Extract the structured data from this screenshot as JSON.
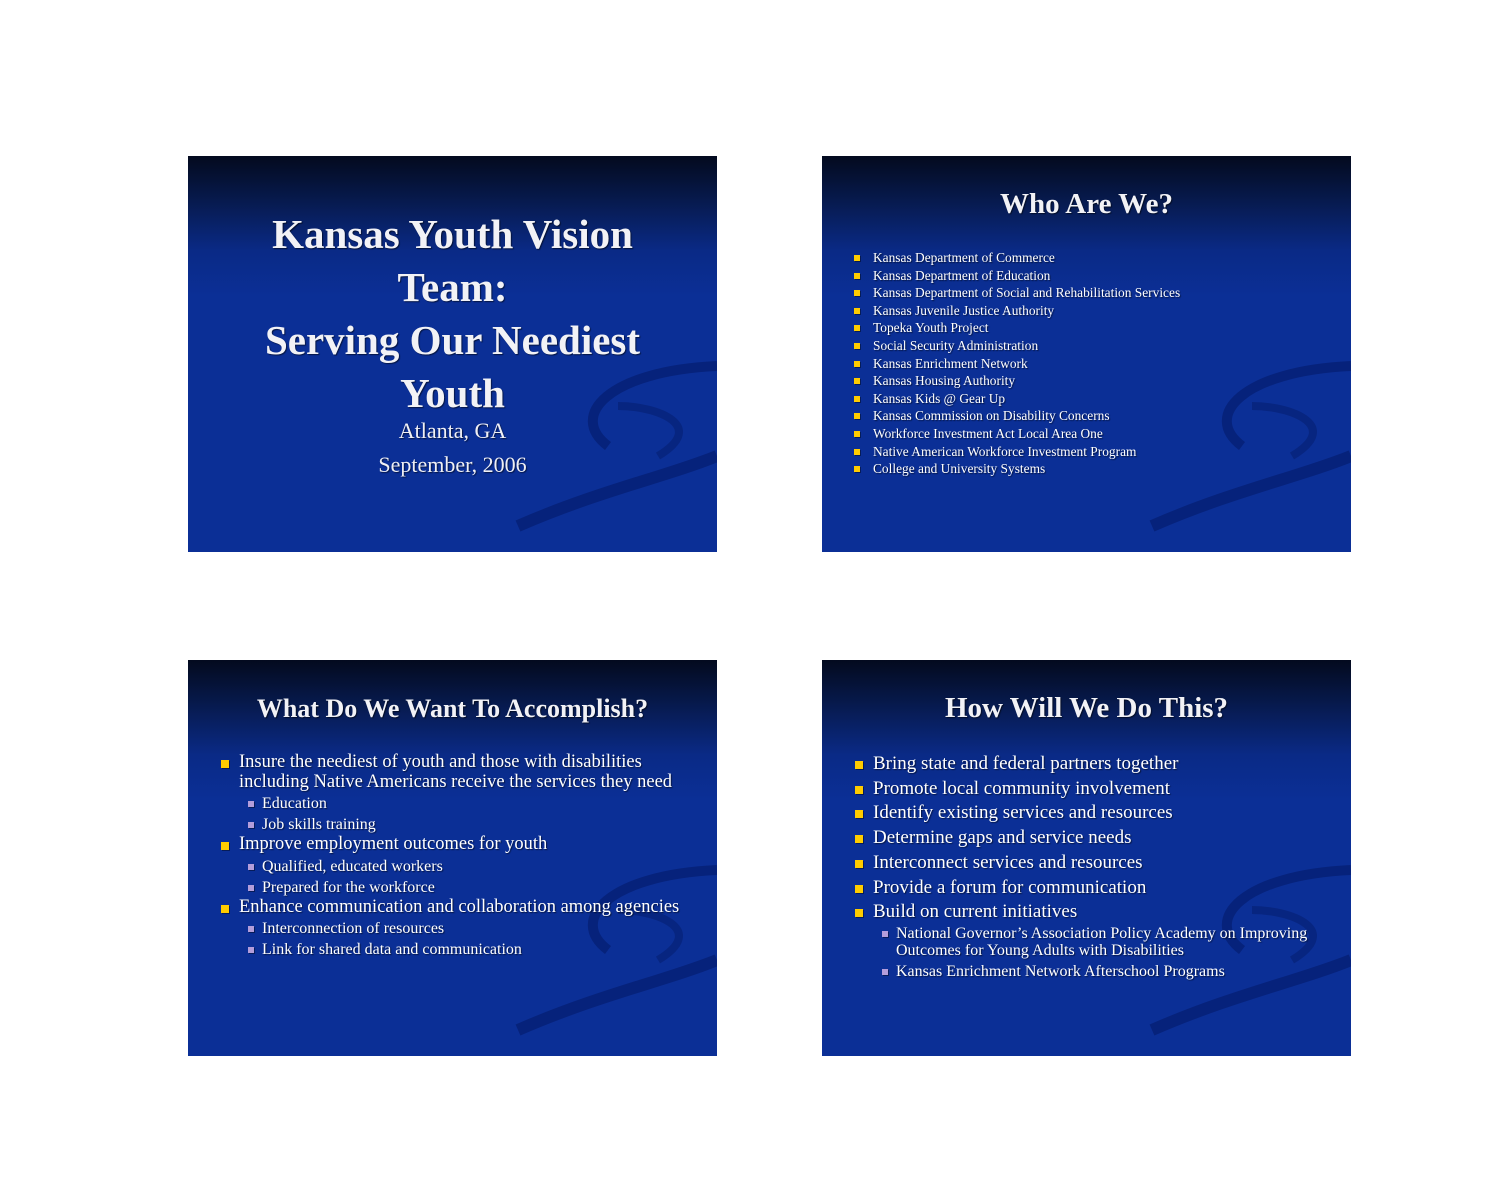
{
  "slides": [
    {
      "title_lines": [
        "Kansas Youth Vision",
        "Team:",
        "Serving Our Neediest",
        "Youth"
      ],
      "subtitle_lines": [
        "Atlanta, GA",
        "September, 2006"
      ]
    },
    {
      "title": "Who Are We?",
      "items": [
        "Kansas Department of Commerce",
        "Kansas Department of Education",
        "Kansas Department of Social and Rehabilitation Services",
        "Kansas Juvenile Justice Authority",
        "Topeka Youth Project",
        "Social Security Administration",
        "Kansas Enrichment Network",
        "Kansas Housing Authority",
        "Kansas Kids @ Gear Up",
        "Kansas Commission on Disability Concerns",
        "Workforce Investment Act Local Area One",
        "Native American Workforce Investment Program",
        "College and University Systems"
      ]
    },
    {
      "title": "What Do We Want To Accomplish?",
      "items": [
        {
          "text": "Insure the neediest of youth and those with disabilities including Native Americans receive the services they need",
          "sub": [
            "Education",
            "Job skills training"
          ]
        },
        {
          "text": "Improve employment outcomes for youth",
          "sub": [
            "Qualified, educated workers",
            "Prepared for the workforce"
          ]
        },
        {
          "text": "Enhance communication and collaboration among agencies",
          "sub": [
            "Interconnection of resources",
            "Link for shared data and communication"
          ]
        }
      ]
    },
    {
      "title": "How Will We Do This?",
      "items": [
        "Bring state and federal partners together",
        "Promote local community involvement",
        "Identify existing services and resources",
        "Determine gaps and service needs",
        "Interconnect services and resources",
        "Provide a forum for communication",
        "Build on current initiatives"
      ],
      "sub_items": [
        "National Governor’s Association Policy Academy on Improving Outcomes for Young Adults with Disabilities",
        "Kansas Enrichment Network Afterschool Programs"
      ]
    }
  ],
  "colors": {
    "background": "#0b2f96",
    "top_band": "#030a1e",
    "bullet_primary": "#ffcc00",
    "bullet_secondary": "#b39ddb",
    "text": "#ffffff"
  }
}
